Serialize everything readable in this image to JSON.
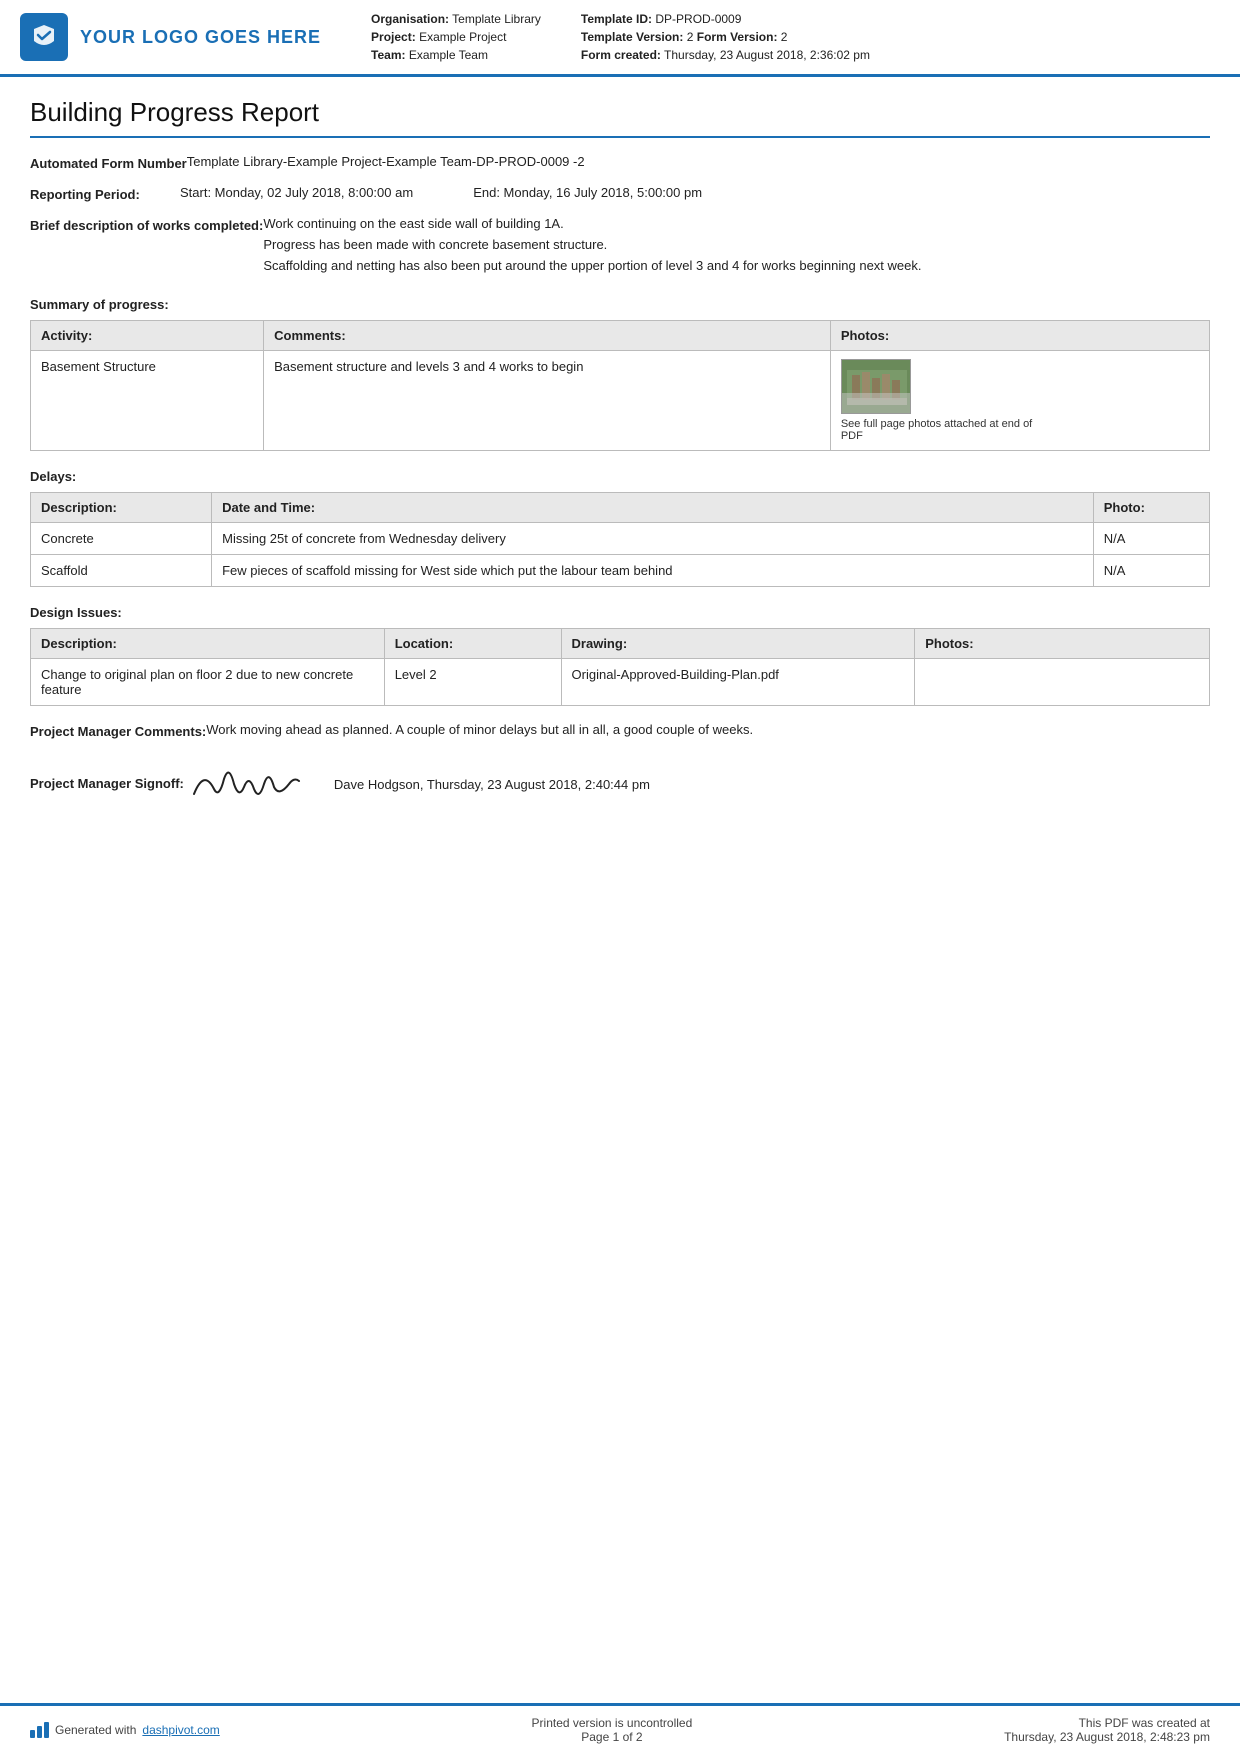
{
  "header": {
    "logo_text": "YOUR LOGO GOES HERE",
    "org_label": "Organisation:",
    "org_value": "Template Library",
    "project_label": "Project:",
    "project_value": "Example Project",
    "team_label": "Team:",
    "team_value": "Example Team",
    "template_id_label": "Template ID:",
    "template_id_value": "DP-PROD-0009",
    "template_version_label": "Template Version:",
    "template_version_value": "2",
    "form_version_label": "Form Version:",
    "form_version_value": "2",
    "form_created_label": "Form created:",
    "form_created_value": "Thursday, 23 August 2018, 2:36:02 pm"
  },
  "page_title": "Building Progress Report",
  "form": {
    "automated_form_number_label": "Automated Form Number",
    "automated_form_number_value": "Template Library-Example Project-Example Team-DP-PROD-0009   -2",
    "reporting_period_label": "Reporting Period:",
    "reporting_period_start": "Start: Monday, 02 July 2018, 8:00:00 am",
    "reporting_period_end": "End: Monday, 16 July 2018, 5:00:00 pm",
    "brief_desc_label": "Brief description of works completed:",
    "brief_desc_lines": [
      "Work continuing on the east side wall of building 1A.",
      "Progress has been made with concrete basement structure.",
      "Scaffolding and netting has also been put around the upper portion of level 3 and 4 for works beginning next week."
    ]
  },
  "summary_section": {
    "heading": "Summary of progress:",
    "table": {
      "headers": [
        "Activity:",
        "Comments:",
        "Photos:"
      ],
      "rows": [
        {
          "activity": "Basement Structure",
          "comments": "Basement structure and levels 3 and 4 works to begin",
          "photo_caption": "See full page photos attached at end of PDF"
        }
      ]
    }
  },
  "delays_section": {
    "heading": "Delays:",
    "table": {
      "headers": [
        "Description:",
        "Date and Time:",
        "Photo:"
      ],
      "rows": [
        {
          "description": "Concrete",
          "date_time": "Missing 25t of concrete from Wednesday delivery",
          "photo": "N/A"
        },
        {
          "description": "Scaffold",
          "date_time": "Few pieces of scaffold missing for West side which put the labour team behind",
          "photo": "N/A"
        }
      ]
    }
  },
  "design_issues_section": {
    "heading": "Design Issues:",
    "table": {
      "headers": [
        "Description:",
        "Location:",
        "Drawing:",
        "Photos:"
      ],
      "rows": [
        {
          "description": "Change to original plan on floor 2 due to new concrete feature",
          "location": "Level 2",
          "drawing": "Original-Approved-Building-Plan.pdf",
          "photos": ""
        }
      ]
    }
  },
  "project_manager_comments": {
    "label": "Project Manager Comments:",
    "value": "Work moving ahead as planned. A couple of minor delays but all in all, a good couple of weeks."
  },
  "project_manager_signoff": {
    "label": "Project Manager Signoff:",
    "signoff_info": "Dave Hodgson, Thursday, 23 August 2018, 2:40:44 pm"
  },
  "footer": {
    "generated_text": "Generated with ",
    "link_text": "dashpivot.com",
    "center_line1": "Printed version is uncontrolled",
    "center_line2": "Page 1 of 2",
    "right_line1": "This PDF was created at",
    "right_line2": "Thursday, 23 August 2018, 2:48:23 pm"
  }
}
